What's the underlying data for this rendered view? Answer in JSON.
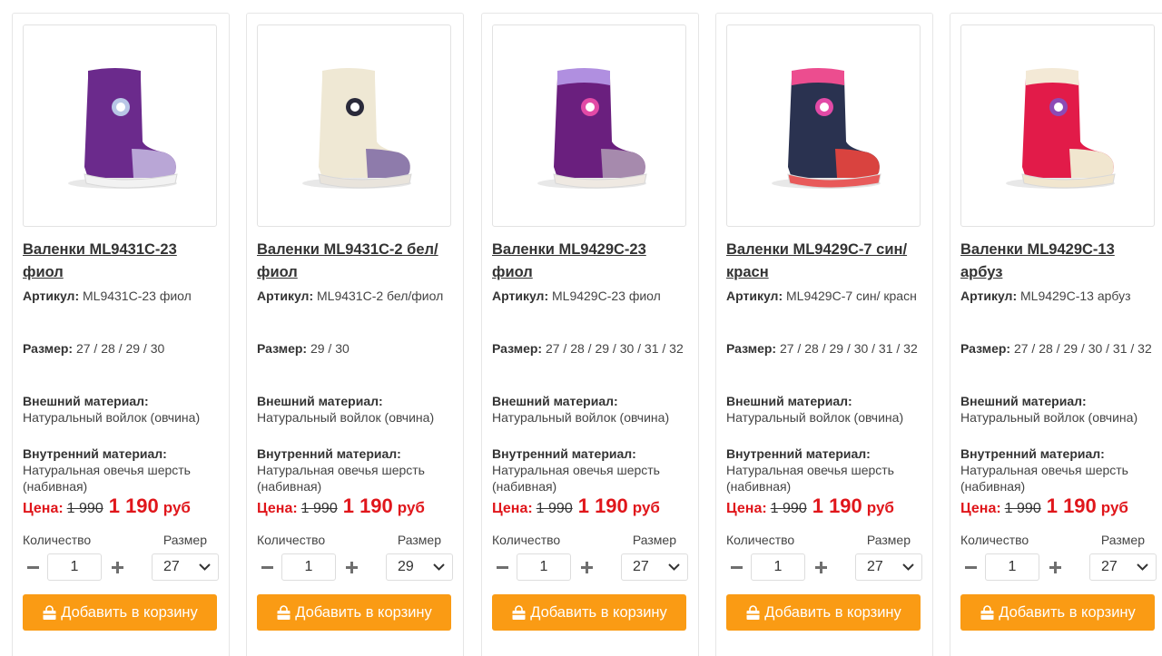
{
  "labels": {
    "sku": "Артикул:",
    "size": "Размер:",
    "outer": "Внешний материал:",
    "inner": "Внутренний материал:",
    "price": "Цена:",
    "currency": "руб",
    "qty": "Количество",
    "size_select": "Размер",
    "add_to_cart": "Добавить в корзину"
  },
  "products": [
    {
      "title": "Валенки ML9431С-23 фиол",
      "sku": "ML9431С-23 фиол",
      "sizes": "27 / 28 / 29 / 30",
      "outer": "Натуральный войлок (овчина)",
      "inner": "Натуральная овечья шерсть (набивная)",
      "old_price": "1 990",
      "new_price": "1 190",
      "qty": "1",
      "selected_size": "27",
      "colors": {
        "body": "#6b2a8c",
        "toe": "#b9a6d6",
        "cuff": "#6b2a8c",
        "sole": "#f2f2f2",
        "flower": "#b8c6e6"
      }
    },
    {
      "title": "Валенки ML9431С-2 бел/фиол",
      "sku": "ML9431С-2 бел/фиол",
      "sizes": "29 / 30",
      "outer": "Натуральный войлок (овчина)",
      "inner": "Натуральная овечья шерсть (набивная)",
      "old_price": "1 990",
      "new_price": "1 190",
      "qty": "1",
      "selected_size": "29",
      "colors": {
        "body": "#efe8d4",
        "toe": "#8e7bab",
        "cuff": "#efe8d4",
        "sole": "#e9e4dc",
        "flower": "#2a2a3a"
      }
    },
    {
      "title": "Валенки ML9429С-23 фиол",
      "sku": "ML9429С-23 фиол",
      "sizes": "27 / 28 / 29 / 30 / 31 / 32",
      "outer": "Натуральный войлок (овчина)",
      "inner": "Натуральная овечья шерсть (набивная)",
      "old_price": "1 990",
      "new_price": "1 190",
      "qty": "1",
      "selected_size": "27",
      "colors": {
        "body": "#6a1f7e",
        "toe": "#a68aad",
        "cuff": "#b08fe0",
        "sole": "#efe9e2",
        "flower": "#e24aa6"
      }
    },
    {
      "title": "Валенки ML9429С-7 син/красн",
      "sku": "ML9429С-7 син/ красн",
      "sizes": "27 / 28 / 29 / 30 / 31 / 32",
      "outer": "Натуральный войлок (овчина)",
      "inner": "Натуральная овечья шерсть (набивная)",
      "old_price": "1 990",
      "new_price": "1 190",
      "qty": "1",
      "selected_size": "27",
      "colors": {
        "body": "#2a3250",
        "toe": "#d9433f",
        "cuff": "#ec4d8f",
        "sole": "#e85a5a",
        "flower": "#e24aa6"
      }
    },
    {
      "title": "Валенки ML9429С-13 арбуз",
      "sku": "ML9429С-13 арбуз",
      "sizes": "27 / 28 / 29 / 30 / 31 / 32",
      "outer": "Натуральный войлок (овчина)",
      "inner": "Натуральная овечья шерсть (набивная)",
      "old_price": "1 990",
      "new_price": "1 190",
      "qty": "1",
      "selected_size": "27",
      "colors": {
        "body": "#e21b49",
        "toe": "#f1e6cf",
        "cuff": "#f3e9d6",
        "sole": "#f1e6cf",
        "flower": "#8c4bb5"
      }
    }
  ]
}
